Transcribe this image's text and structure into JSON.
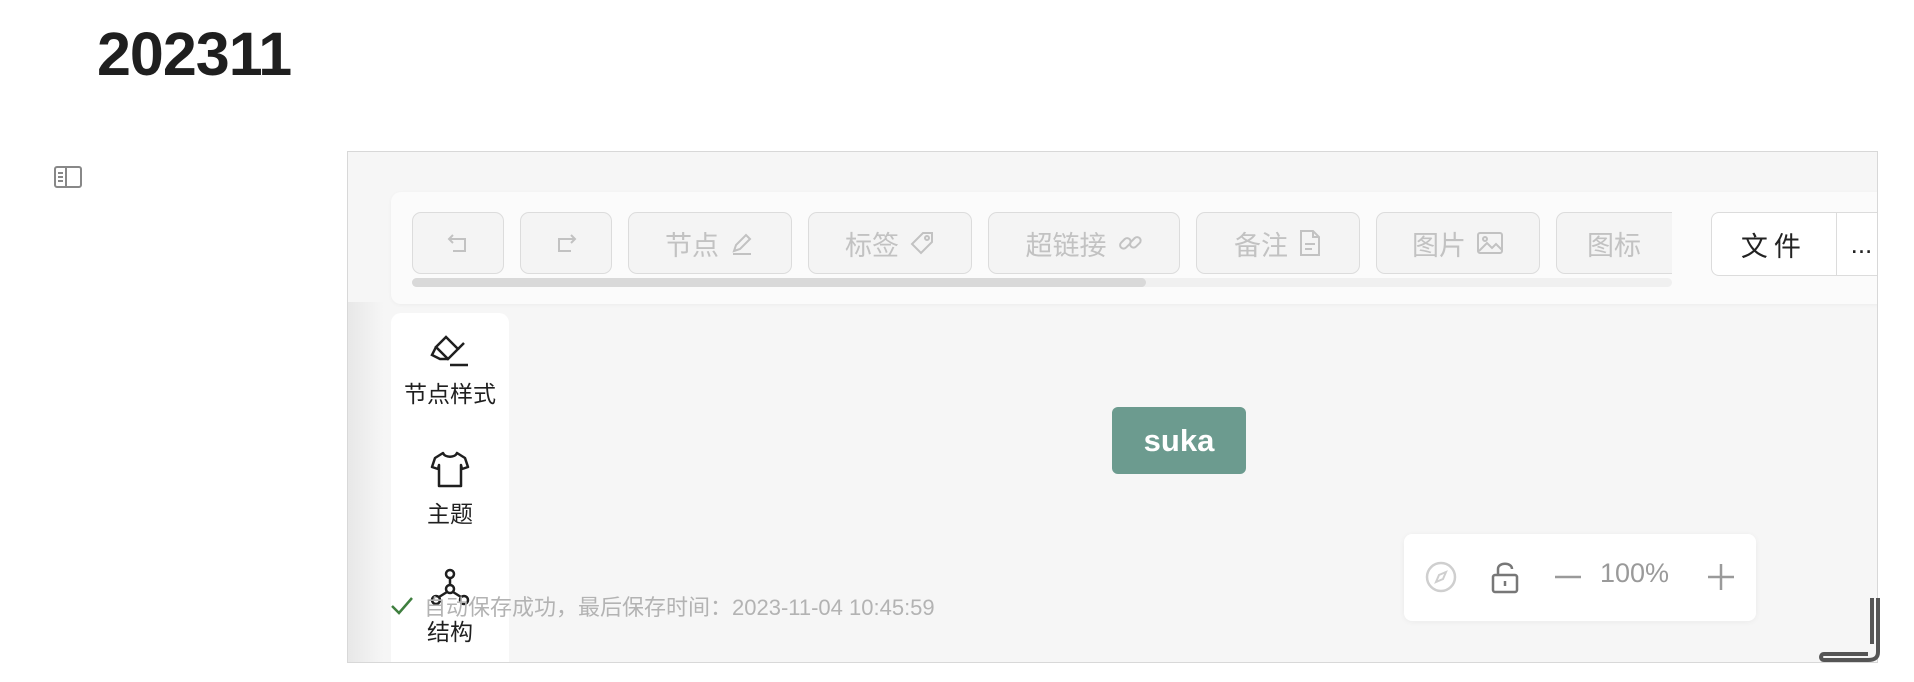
{
  "page": {
    "title": "202311"
  },
  "toolbar": {
    "undo_icon": "undo-icon",
    "redo_icon": "redo-icon",
    "node_label": "节点",
    "tag_label": "标签",
    "link_label": "超链接",
    "note_label": "备注",
    "image_label": "图片",
    "icon_label": "图标",
    "file_label": "文件",
    "more_label": "..."
  },
  "side_panel": {
    "items": [
      {
        "label": "节点样式",
        "icon": "highlighter-icon"
      },
      {
        "label": "主题",
        "icon": "shirt-icon"
      },
      {
        "label": "结构",
        "icon": "structure-icon"
      }
    ]
  },
  "canvas": {
    "root_node": "suka"
  },
  "zoom": {
    "level": "100%"
  },
  "status": {
    "save_message": "自动保存成功，最后保存时间：2023-11-04 10:45:59"
  },
  "colors": {
    "root_node_bg": "#6c9b8f",
    "success_check": "#3f7f3f"
  }
}
